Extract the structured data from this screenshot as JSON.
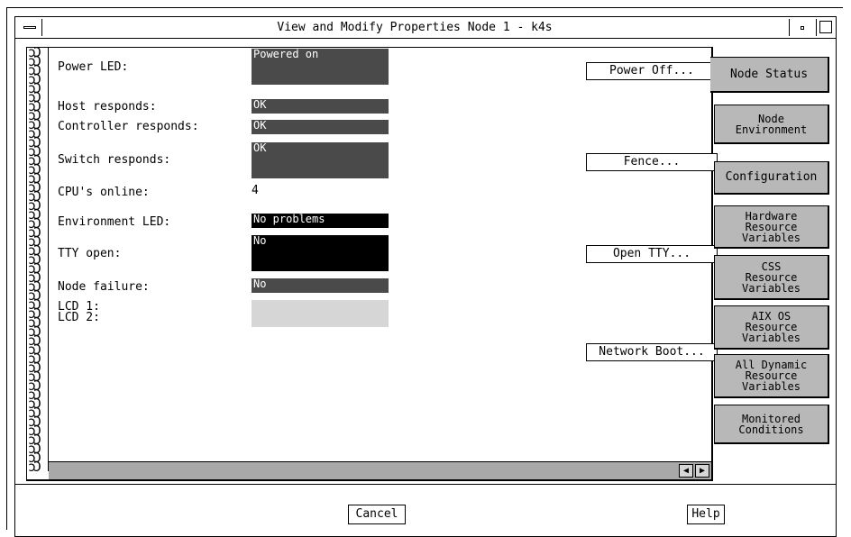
{
  "window": {
    "title": "View and Modify Properties Node 1 - k4s"
  },
  "fields": {
    "power_led": {
      "label": "Power LED:",
      "value": "Powered on"
    },
    "host_responds": {
      "label": "Host responds:",
      "value": "OK"
    },
    "controller_responds": {
      "label": "Controller responds:",
      "value": "OK"
    },
    "switch_responds": {
      "label": "Switch responds:",
      "value": "OK"
    },
    "cpus_online": {
      "label": "CPU's online:",
      "value": "4"
    },
    "environment_led": {
      "label": "Environment LED:",
      "value": "No problems"
    },
    "tty_open": {
      "label": "TTY open:",
      "value": "No"
    },
    "node_failure": {
      "label": "Node failure:",
      "value": "No"
    },
    "lcd1": {
      "label": "LCD 1:",
      "value": ""
    },
    "lcd2": {
      "label": "LCD 2:",
      "value": ""
    }
  },
  "actions": {
    "power_off": "Power Off...",
    "fence": "Fence...",
    "open_tty": "Open TTY...",
    "network_boot": "Network Boot..."
  },
  "tabs": [
    {
      "label": "Node Status",
      "active": true
    },
    {
      "label": "Node\nEnvironment"
    },
    {
      "label": "Configuration"
    },
    {
      "label": "Hardware\nResource\nVariables"
    },
    {
      "label": "CSS\nResource\nVariables"
    },
    {
      "label": "AIX OS\nResource\nVariables"
    },
    {
      "label": "All Dynamic\nResource\nVariables"
    },
    {
      "label": "Monitored\nConditions"
    }
  ],
  "footer": {
    "cancel": "Cancel",
    "help": "Help"
  },
  "icons": {
    "window_menu": "window-menu-icon",
    "minimize": "minimize-icon",
    "maximize": "maximize-icon",
    "scroll_left": "scroll-left-arrow-icon",
    "scroll_right": "scroll-right-arrow-icon",
    "spiral": "notebook-spiral-icon"
  },
  "colors": {
    "field_gray": "#4a4a4a",
    "field_black": "#000000",
    "field_empty": "#d6d6d6",
    "tab_bg": "#b8b8b8"
  }
}
